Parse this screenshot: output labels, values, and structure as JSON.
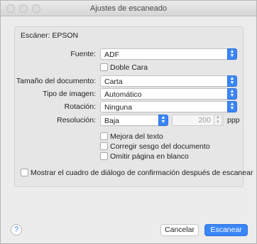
{
  "window": {
    "title": "Ajustes de escaneado"
  },
  "scanner": {
    "label": "Escáner: EPSON"
  },
  "fields": {
    "source": {
      "label": "Fuente:",
      "value": "ADF"
    },
    "duplex": {
      "label": "Doble Cara",
      "checked": false
    },
    "doc_size": {
      "label": "Tamaño del documento:",
      "value": "Carta"
    },
    "image_type": {
      "label": "Tipo de imagen:",
      "value": "Automático"
    },
    "rotation": {
      "label": "Rotación:",
      "value": "Ninguna"
    },
    "resolution": {
      "label": "Resolución:",
      "value": "Baja",
      "dpi": "200",
      "unit": "ppp"
    }
  },
  "options": [
    {
      "label": "Mejora del texto",
      "checked": false
    },
    {
      "label": "Corregir sesgo del documento",
      "checked": false
    },
    {
      "label": "Omitir página en blanco",
      "checked": false
    }
  ],
  "confirm": {
    "label": "Mostrar el cuadro de diálogo de confirmación después de escanear",
    "checked": false
  },
  "buttons": {
    "help": "?",
    "cancel": "Cancelar",
    "scan": "Escanear"
  },
  "colors": {
    "accent": "#3b86f7"
  }
}
